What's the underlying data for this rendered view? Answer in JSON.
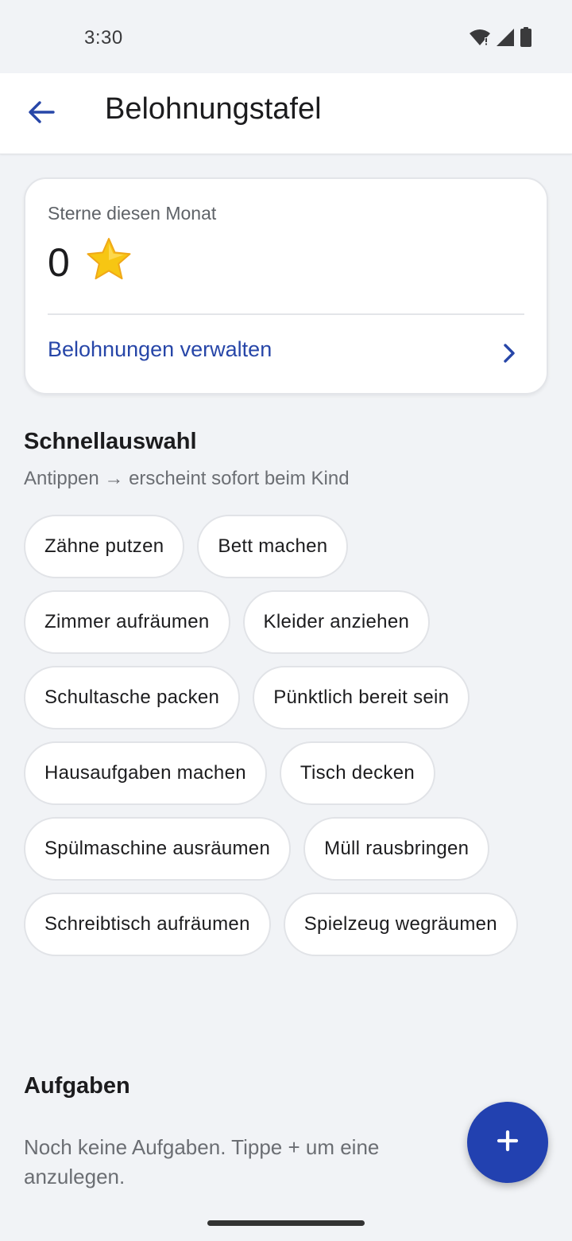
{
  "status_bar": {
    "time": "3:30"
  },
  "app_bar": {
    "title": "Belohnungstafel",
    "back_icon": "arrow-left-icon"
  },
  "stars_card": {
    "label": "Sterne diesen Monat",
    "count": "0",
    "star_icon": "star-icon",
    "manage_label": "Belohnungen verwalten"
  },
  "quick_select": {
    "title": "Schnellauswahl",
    "subtitle": "Antippen → erscheint sofort beim Kind",
    "chips": [
      "Zähne putzen",
      "Bett machen",
      "Zimmer aufräumen",
      "Kleider anziehen",
      "Schultasche packen",
      "Pünktlich bereit sein",
      "Hausaufgaben machen",
      "Tisch decken",
      "Spülmaschine ausräumen",
      "Müll rausbringen",
      "Schreibtisch aufräumen",
      "Spielzeug wegräumen"
    ]
  },
  "tasks": {
    "title": "Aufgaben",
    "empty_text": "Noch keine Aufgaben. Tippe + um eine anzulegen."
  },
  "colors": {
    "accent": "#2241b0",
    "link": "#2746a8",
    "background": "#f1f3f6",
    "star": "#f7c613"
  }
}
